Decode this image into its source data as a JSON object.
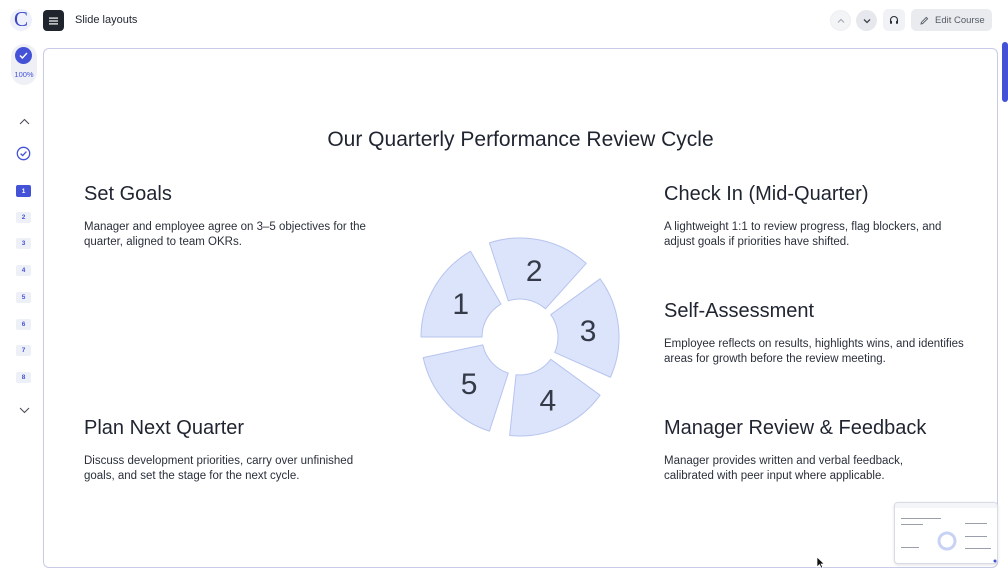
{
  "app": {
    "logo_letter": "C",
    "title": "Slide layouts",
    "edit_button": "Edit Course",
    "icons": {
      "menu": "hamburger-menu-icon",
      "prev": "chevron-up-icon",
      "next": "chevron-down-icon",
      "audio": "headphones-icon",
      "edit": "pencil-icon"
    }
  },
  "sidebar": {
    "progress": "100%",
    "progress_value": 1.0,
    "slides": [
      "1",
      "2",
      "3",
      "4",
      "5",
      "6",
      "7",
      "8"
    ],
    "active_slide": "1"
  },
  "slide": {
    "title": "Our Quarterly Performance Review Cycle",
    "steps": [
      {
        "heading": "Set Goals",
        "body": "Manager and employee agree on 3–5 objectives for the quarter, aligned to team OKRs."
      },
      {
        "heading": "Check In (Mid-Quarter)",
        "body": "A lightweight 1:1 to review progress, flag blockers, and adjust goals if priorities have shifted."
      },
      {
        "heading": "Self-Assessment",
        "body": "Employee reflects on results, highlights wins, and identifies areas for growth before the review meeting."
      },
      {
        "heading": "Manager Review & Feedback",
        "body": "Manager provides written and verbal feedback, calibrated with peer input where applicable."
      },
      {
        "heading": "Plan Next Quarter",
        "body": "Discuss development priorities, carry over unfinished goals, and set the stage for the next cycle."
      }
    ],
    "cycle_numbers": [
      "1",
      "2",
      "3",
      "4",
      "5"
    ]
  },
  "colors": {
    "accent": "#4452d8",
    "segment_fill": "#dce4fb",
    "segment_stroke": "#b7c4ee"
  }
}
